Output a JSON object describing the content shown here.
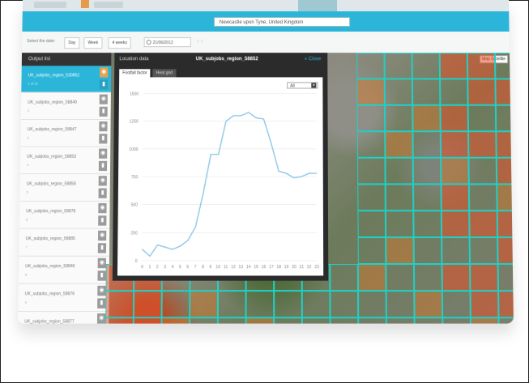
{
  "header": {
    "search_text": "Newcastle upon Tyne, United Kingdom"
  },
  "toolbar": {
    "label": "Select the date:",
    "buttons": [
      "Day",
      "Week",
      "4 weeks"
    ],
    "date": "21/06/2012"
  },
  "sidebar": {
    "heading": "Output list",
    "items": [
      {
        "name": "UK_subjobs_region_530852",
        "sub": "1 of 12",
        "active": true
      },
      {
        "name": "UK_subjobs_region_58849",
        "sub": "2",
        "active": false
      },
      {
        "name": "UK_subjobs_region_58847",
        "sub": "3",
        "active": false
      },
      {
        "name": "UK_subjobs_region_58853",
        "sub": "4",
        "active": false
      },
      {
        "name": "UK_subjobs_region_58858",
        "sub": "5",
        "active": false
      },
      {
        "name": "UK_subjobs_region_58878",
        "sub": "6",
        "active": false
      },
      {
        "name": "UK_subjobs_region_58885",
        "sub": "7",
        "active": false
      },
      {
        "name": "UK_subjobs_region_58846",
        "sub": "8",
        "active": false
      },
      {
        "name": "UK_subjobs_region_58876",
        "sub": "9",
        "active": false
      },
      {
        "name": "UK_subjobs_region_58877",
        "sub": "10",
        "active": false
      }
    ]
  },
  "panel": {
    "location_label": "Location data",
    "title": "UK_subjobs_region_58852",
    "close_label": "« Close",
    "tabs": [
      "Footfall factor",
      "Heat grid"
    ],
    "dropdown_value": "All"
  },
  "map": {
    "view_buttons": "Map Satellite"
  },
  "colors": {
    "accent": "#2bb6d9",
    "orange": "#e9a24c",
    "grid": "#1fd0c5",
    "line": "#8fc7e8"
  },
  "chart_data": {
    "type": "line",
    "x": [
      0,
      1,
      2,
      3,
      4,
      5,
      6,
      7,
      8,
      9,
      10,
      11,
      12,
      13,
      14,
      15,
      16,
      17,
      18,
      19,
      20,
      21,
      22,
      23
    ],
    "values": [
      100,
      40,
      140,
      120,
      100,
      130,
      180,
      300,
      600,
      950,
      950,
      1250,
      1300,
      1300,
      1330,
      1280,
      1270,
      1050,
      800,
      780,
      740,
      750,
      780,
      780
    ],
    "ylim": [
      0,
      1500
    ],
    "yticks": [
      0,
      250,
      500,
      750,
      1000,
      1250,
      1500
    ],
    "xlabel": "",
    "ylabel": "",
    "grid": true
  }
}
